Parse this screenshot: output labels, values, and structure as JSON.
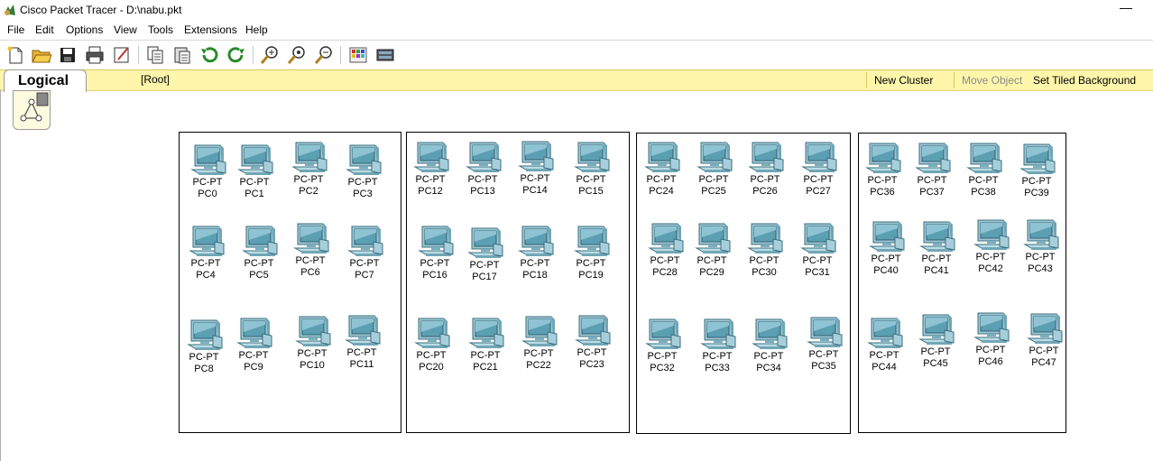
{
  "window": {
    "title": "Cisco Packet Tracer - D:\\nabu.pkt",
    "minimize_label": "—"
  },
  "menu": [
    "File",
    "Edit",
    "Options",
    "View",
    "Tools",
    "Extensions",
    "Help"
  ],
  "toolbar_icons": [
    "new-icon",
    "open-icon",
    "save-icon",
    "print-icon",
    "activity-wizard-icon",
    "copy-icon",
    "paste-icon",
    "undo-icon",
    "redo-icon",
    "zoom-in-icon",
    "zoom-reset-icon",
    "zoom-out-icon",
    "palette-icon",
    "device-dialog-icon"
  ],
  "workspace": {
    "tab_label": "Logical",
    "root_label": "[Root]",
    "new_cluster": "New Cluster",
    "move_object": "Move Object",
    "set_tiled_background": "Set Tiled Background"
  },
  "devices": [
    {
      "type": "PC-PT",
      "name": "PC0"
    },
    {
      "type": "PC-PT",
      "name": "PC1"
    },
    {
      "type": "PC-PT",
      "name": "PC2"
    },
    {
      "type": "PC-PT",
      "name": "PC3"
    },
    {
      "type": "PC-PT",
      "name": "PC4"
    },
    {
      "type": "PC-PT",
      "name": "PC5"
    },
    {
      "type": "PC-PT",
      "name": "PC6"
    },
    {
      "type": "PC-PT",
      "name": "PC7"
    },
    {
      "type": "PC-PT",
      "name": "PC8"
    },
    {
      "type": "PC-PT",
      "name": "PC9"
    },
    {
      "type": "PC-PT",
      "name": "PC10"
    },
    {
      "type": "PC-PT",
      "name": "PC11"
    },
    {
      "type": "PC-PT",
      "name": "PC12"
    },
    {
      "type": "PC-PT",
      "name": "PC13"
    },
    {
      "type": "PC-PT",
      "name": "PC14"
    },
    {
      "type": "PC-PT",
      "name": "PC15"
    },
    {
      "type": "PC-PT",
      "name": "PC16"
    },
    {
      "type": "PC-PT",
      "name": "PC17"
    },
    {
      "type": "PC-PT",
      "name": "PC18"
    },
    {
      "type": "PC-PT",
      "name": "PC19"
    },
    {
      "type": "PC-PT",
      "name": "PC20"
    },
    {
      "type": "PC-PT",
      "name": "PC21"
    },
    {
      "type": "PC-PT",
      "name": "PC22"
    },
    {
      "type": "PC-PT",
      "name": "PC23"
    },
    {
      "type": "PC-PT",
      "name": "PC24"
    },
    {
      "type": "PC-PT",
      "name": "PC25"
    },
    {
      "type": "PC-PT",
      "name": "PC26"
    },
    {
      "type": "PC-PT",
      "name": "PC27"
    },
    {
      "type": "PC-PT",
      "name": "PC28"
    },
    {
      "type": "PC-PT",
      "name": "PC29"
    },
    {
      "type": "PC-PT",
      "name": "PC30"
    },
    {
      "type": "PC-PT",
      "name": "PC31"
    },
    {
      "type": "PC-PT",
      "name": "PC32"
    },
    {
      "type": "PC-PT",
      "name": "PC33"
    },
    {
      "type": "PC-PT",
      "name": "PC34"
    },
    {
      "type": "PC-PT",
      "name": "PC35"
    },
    {
      "type": "PC-PT",
      "name": "PC36"
    },
    {
      "type": "PC-PT",
      "name": "PC37"
    },
    {
      "type": "PC-PT",
      "name": "PC38"
    },
    {
      "type": "PC-PT",
      "name": "PC39"
    },
    {
      "type": "PC-PT",
      "name": "PC40"
    },
    {
      "type": "PC-PT",
      "name": "PC41"
    },
    {
      "type": "PC-PT",
      "name": "PC42"
    },
    {
      "type": "PC-PT",
      "name": "PC43"
    },
    {
      "type": "PC-PT",
      "name": "PC44"
    },
    {
      "type": "PC-PT",
      "name": "PC45"
    },
    {
      "type": "PC-PT",
      "name": "PC46"
    },
    {
      "type": "PC-PT",
      "name": "PC47"
    }
  ]
}
